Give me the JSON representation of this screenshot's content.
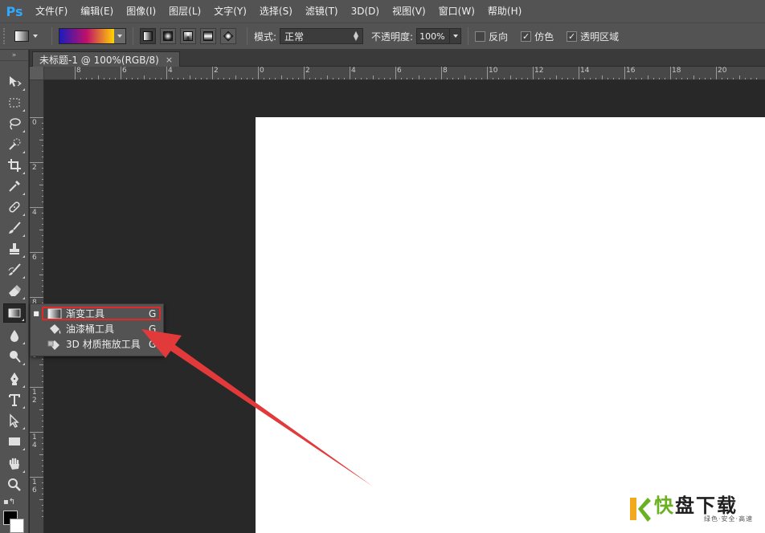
{
  "app": {
    "logo": "Ps"
  },
  "menu": [
    "文件(F)",
    "编辑(E)",
    "图像(I)",
    "图层(L)",
    "文字(Y)",
    "选择(S)",
    "滤镜(T)",
    "3D(D)",
    "视图(V)",
    "窗口(W)",
    "帮助(H)"
  ],
  "options": {
    "gradient_colors": [
      "#1b1bbd",
      "#c0106a",
      "#ffd400"
    ],
    "gradient_types": [
      "linear",
      "radial",
      "angle",
      "reflected",
      "diamond"
    ],
    "active_gradient_type": "linear",
    "mode_label": "模式:",
    "mode_value": "正常",
    "opacity_label": "不透明度:",
    "opacity_value": "100%",
    "reverse_label": "反向",
    "reverse_checked": false,
    "dither_label": "仿色",
    "dither_checked": true,
    "transparency_label": "透明区域",
    "transparency_checked": true
  },
  "document": {
    "tab_title": "未标题-1 @ 100%(RGB/8)",
    "close_glyph": "×"
  },
  "ruler": {
    "h_labels": [
      "8",
      "6",
      "4",
      "2",
      "0",
      "2",
      "4",
      "6",
      "8",
      "10",
      "12",
      "14",
      "16",
      "18",
      "20"
    ],
    "v_labels": [
      "0",
      "2",
      "4",
      "6",
      "8",
      "1 0",
      "1 2",
      "1 4",
      "1 6"
    ]
  },
  "tools": [
    {
      "name": "move-tool",
      "icon": "move-icon"
    },
    {
      "name": "marquee-tool",
      "icon": "rect-marquee-icon"
    },
    {
      "name": "lasso-tool",
      "icon": "lasso-icon"
    },
    {
      "name": "quick-select-tool",
      "icon": "quick-select-icon"
    },
    {
      "name": "crop-tool",
      "icon": "crop-icon"
    },
    {
      "name": "eyedropper-tool",
      "icon": "eyedropper-icon"
    },
    {
      "name": "healing-tool",
      "icon": "bandage-icon"
    },
    {
      "name": "brush-tool",
      "icon": "brush-icon"
    },
    {
      "name": "stamp-tool",
      "icon": "stamp-icon"
    },
    {
      "name": "history-brush-tool",
      "icon": "history-brush-icon"
    },
    {
      "name": "eraser-tool",
      "icon": "eraser-icon"
    },
    {
      "name": "gradient-tool",
      "icon": "gradient-icon"
    },
    {
      "name": "blur-tool",
      "icon": "drop-icon"
    },
    {
      "name": "dodge-tool",
      "icon": "dodge-icon"
    },
    {
      "name": "pen-tool",
      "icon": "pen-icon"
    },
    {
      "name": "type-tool",
      "icon": "type-icon"
    },
    {
      "name": "path-select-tool",
      "icon": "arrow-select-icon"
    },
    {
      "name": "shape-tool",
      "icon": "rectangle-icon"
    },
    {
      "name": "hand-tool",
      "icon": "hand-icon"
    },
    {
      "name": "zoom-tool",
      "icon": "magnifier-icon"
    }
  ],
  "flyout": {
    "items": [
      {
        "label": "渐变工具",
        "shortcut": "G",
        "icon": "gradient-icon",
        "selected": true
      },
      {
        "label": "油漆桶工具",
        "shortcut": "G",
        "icon": "paint-bucket-icon",
        "selected": false
      },
      {
        "label": "3D 材质拖放工具",
        "shortcut": "G",
        "icon": "3d-material-drop-icon",
        "selected": false
      }
    ],
    "highlight_color": "#e02a2a"
  },
  "watermark": {
    "char": "快",
    "brand": "盘下载",
    "tagline": "绿色·安全·高速"
  }
}
